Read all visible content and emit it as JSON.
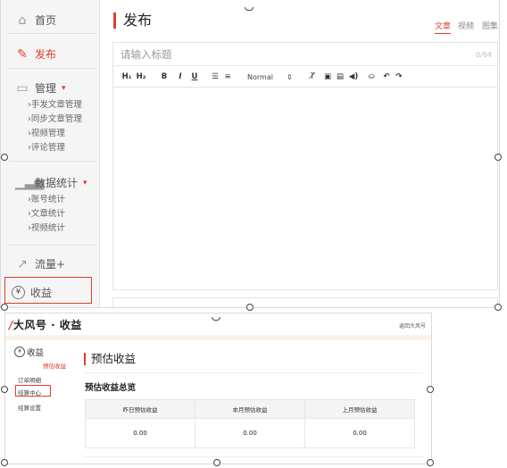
{
  "top": {
    "sidebar": {
      "home": {
        "label": "首页",
        "icon": "home-icon"
      },
      "publish": {
        "label": "发布",
        "icon": "edit-icon"
      },
      "manage": {
        "label": "管理",
        "icon": "folder-icon",
        "items": [
          "手发文章管理",
          "同步文章管理",
          "视频管理",
          "评论管理"
        ]
      },
      "stats": {
        "label": "数据统计",
        "icon": "bar-chart-icon",
        "items": [
          "账号统计",
          "文章统计",
          "视频统计"
        ]
      },
      "traffic": {
        "label": "流量+",
        "icon": "trend-icon"
      },
      "income": {
        "label": "收益",
        "icon": "yen-icon"
      }
    },
    "title": "发布",
    "tabs": [
      "文章",
      "视频",
      "图集"
    ],
    "editor": {
      "title_placeholder": "请输入标题",
      "char_count": "0/64",
      "toolbar": [
        "H₁",
        "H₂",
        "B",
        "I",
        "U",
        "ordered-list",
        "bullet-list",
        "Normal",
        "clear-format",
        "image",
        "video",
        "audio",
        "basket",
        "undo",
        "redo"
      ],
      "format_value": "Normal"
    }
  },
  "bottom": {
    "logo": "大风号 · 收益",
    "back_link": "返回大风号",
    "side": {
      "title": "收益",
      "items": [
        "预估收益",
        "订单明细",
        "结算中心",
        "结算设置"
      ]
    },
    "page_title": "预估收益",
    "section_title": "预估收益总览",
    "table": {
      "headers": [
        "昨日预估收益",
        "本月预估收益",
        "上月预估收益"
      ],
      "values": [
        "0.00",
        "0.00",
        "0.00"
      ]
    }
  },
  "colors": {
    "accent": "#e23d2b",
    "sidebar_bg": "#f5f5f5"
  }
}
